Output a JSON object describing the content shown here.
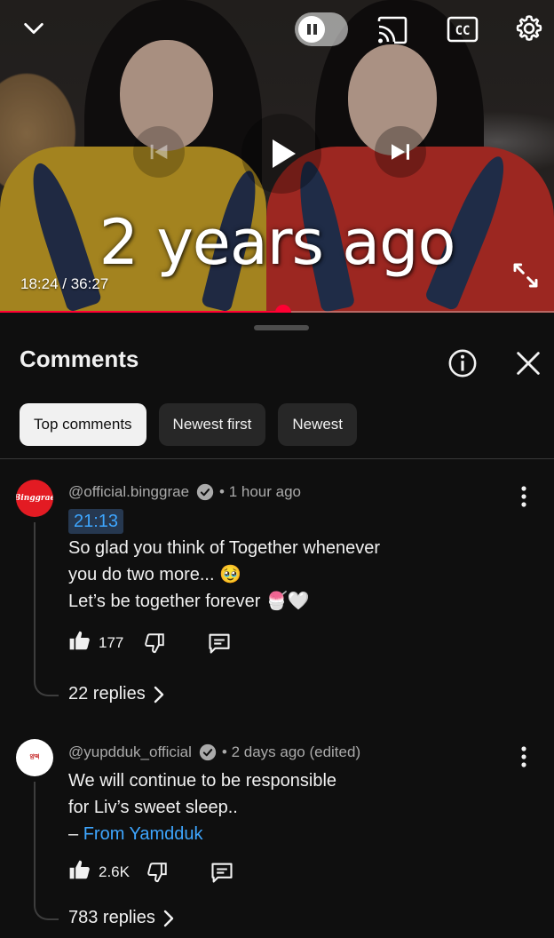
{
  "player": {
    "overlay_text": "2 years ago",
    "time_current": "18:24",
    "time_total": "36:27",
    "time_display": "18:24 / 36:27",
    "progress_percent": 51.1,
    "cc_label": "CC"
  },
  "comments_panel": {
    "title": "Comments",
    "chips": [
      "Top comments",
      "Newest first",
      "Newest"
    ],
    "active_chip": 0,
    "comments": [
      {
        "author": "@official.binggrae",
        "verified": true,
        "time": "1 hour ago",
        "avatar_text": "Binggrae",
        "timestamp_link": "21:13",
        "lines": [
          "So glad you think of Together whenever",
          "you do two more... 🥹",
          "Let’s be together forever 🍧🤍"
        ],
        "likes": "177",
        "replies": "22 replies"
      },
      {
        "author": "@yupdduk_official",
        "verified": true,
        "time": "2 days ago (edited)",
        "avatar_text": "얌떡",
        "lines": [
          "We will continue to be responsible",
          "for Liv’s sweet sleep.."
        ],
        "signature_prefix": "– ",
        "signature_link": "From Yamdduk",
        "likes": "2.6K",
        "replies": "783 replies"
      }
    ]
  },
  "colors": {
    "background": "#0f0f0f",
    "progress": "#ff0033",
    "link": "#3ea6ff",
    "chip_active_bg": "#f1f1f1",
    "chip_bg": "#272727"
  },
  "icons": [
    "chevron-down-icon",
    "pause-icon",
    "cast-icon",
    "cc-icon",
    "settings-gear-icon",
    "previous-icon",
    "play-icon",
    "next-icon",
    "fullscreen-icon",
    "info-icon",
    "close-icon",
    "verified-check-icon",
    "like-icon",
    "dislike-icon",
    "reply-icon",
    "more-vert-icon",
    "chevron-right-icon"
  ]
}
